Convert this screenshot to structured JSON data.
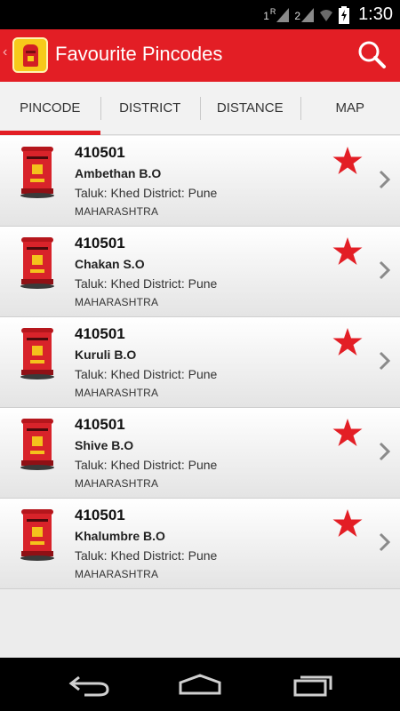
{
  "status_bar": {
    "sim1": "1",
    "sim1_tag": "R",
    "sim2": "2",
    "time": "1:30"
  },
  "action_bar": {
    "title": "Favourite Pincodes",
    "search_icon": "search-icon",
    "brand_color": "#e31e25"
  },
  "tabs": [
    {
      "label": "PINCODE",
      "active": true
    },
    {
      "label": "DISTRICT",
      "active": false
    },
    {
      "label": "DISTANCE",
      "active": false
    },
    {
      "label": "MAP",
      "active": false
    }
  ],
  "items": [
    {
      "pincode": "410501",
      "office": "Ambethan B.O",
      "taluk_district": "Taluk: Khed  District: Pune",
      "state": "MAHARASHTRA"
    },
    {
      "pincode": "410501",
      "office": "Chakan S.O",
      "taluk_district": "Taluk: Khed  District: Pune",
      "state": "MAHARASHTRA"
    },
    {
      "pincode": "410501",
      "office": "Kuruli B.O",
      "taluk_district": "Taluk: Khed  District: Pune",
      "state": "MAHARASHTRA"
    },
    {
      "pincode": "410501",
      "office": "Shive B.O",
      "taluk_district": "Taluk: Khed  District: Pune",
      "state": "MAHARASHTRA"
    },
    {
      "pincode": "410501",
      "office": "Khalumbre B.O",
      "taluk_district": "Taluk: Khed  District: Pune",
      "state": "MAHARASHTRA"
    }
  ],
  "nav_bar": {
    "back_icon": "back-icon",
    "home_icon": "home-icon",
    "recents_icon": "recents-icon"
  }
}
